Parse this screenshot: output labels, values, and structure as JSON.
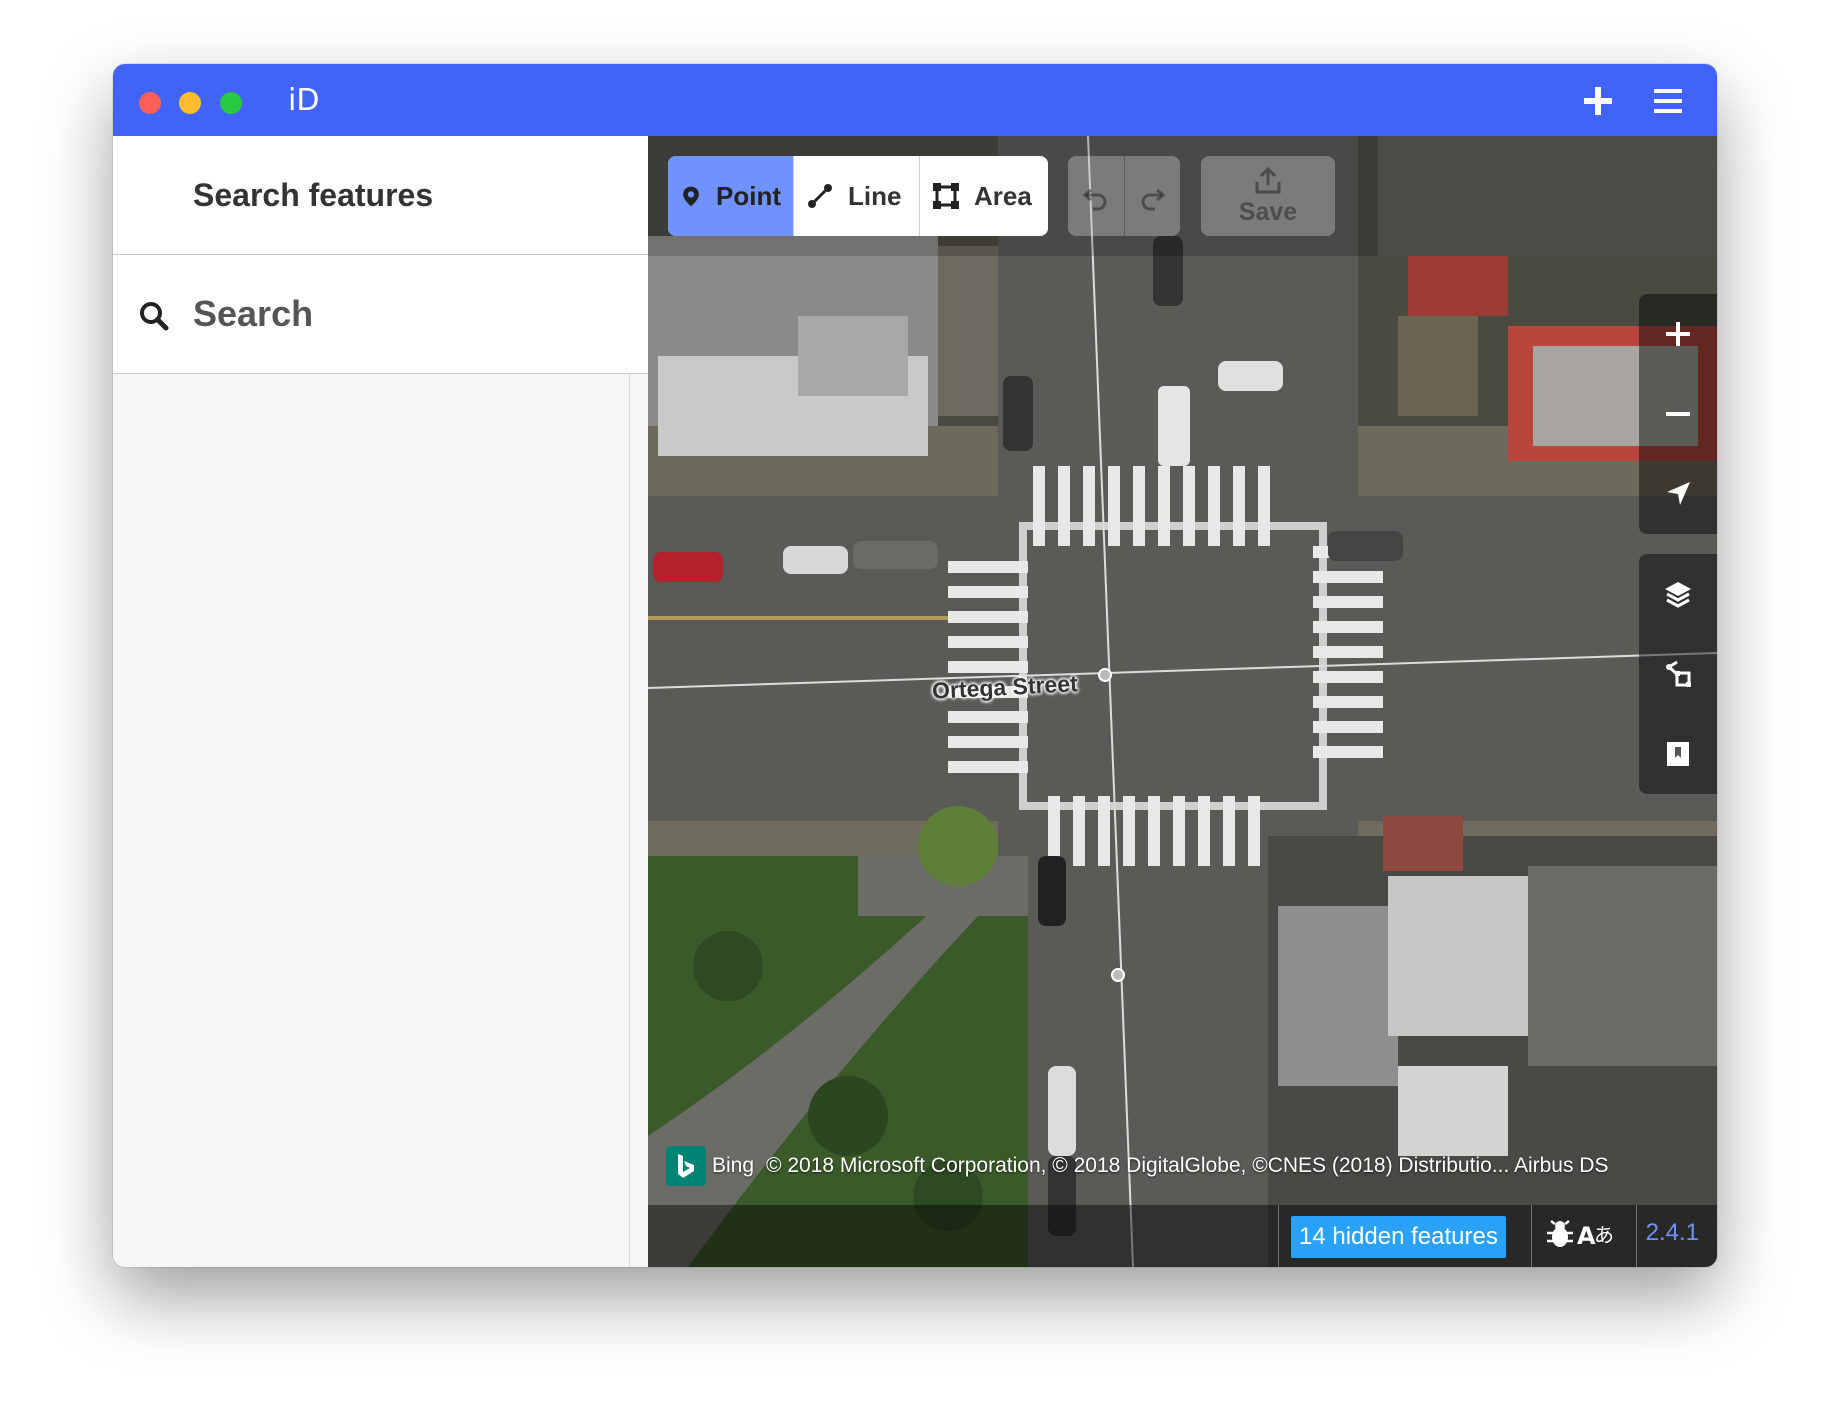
{
  "window": {
    "app_title": "iD",
    "titlebar_color": "#4263fa"
  },
  "sidebar": {
    "header_title": "Search features",
    "search_placeholder": "Search"
  },
  "toolbar": {
    "modes": [
      {
        "label": "Point",
        "icon": "point-marker-icon",
        "active": true
      },
      {
        "label": "Line",
        "icon": "line-icon",
        "active": false
      },
      {
        "label": "Area",
        "icon": "area-icon",
        "active": false
      }
    ],
    "save_label": "Save",
    "active_color": "#7092ff"
  },
  "map": {
    "street_label": "Ortega Street",
    "attribution_provider": "Bing",
    "attribution_text": "© 2018 Microsoft Corporation, © 2018 DigitalGlobe, ©CNES (2018) Distributio... Airbus DS"
  },
  "footer": {
    "hidden_features": "14 hidden features",
    "version": "2.4.1",
    "hidden_badge_color": "#2aa2fb"
  },
  "controls": [
    "zoom-in-icon",
    "zoom-out-icon",
    "geolocate-icon",
    "layers-icon",
    "map-data-icon",
    "help-icon"
  ]
}
